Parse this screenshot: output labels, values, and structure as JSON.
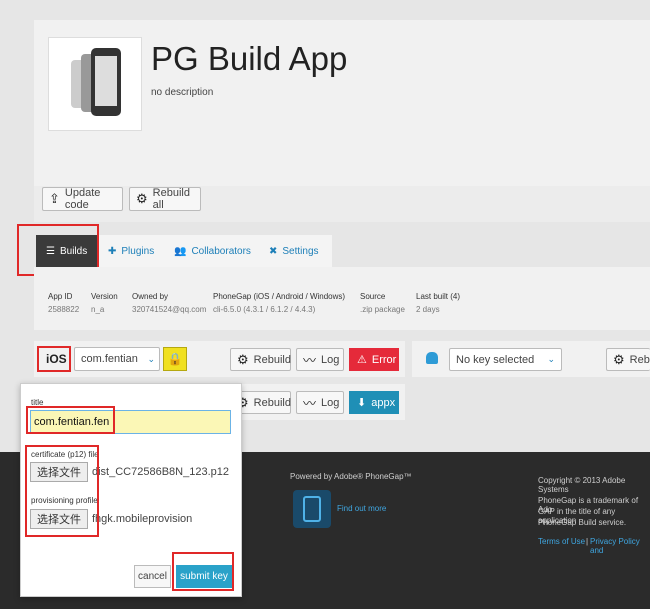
{
  "app": {
    "title": "PG Build App",
    "description": "no description"
  },
  "actions": {
    "update_code": "Update code",
    "rebuild_all": "Rebuild all"
  },
  "tabs": [
    {
      "label": "Builds"
    },
    {
      "label": "Plugins"
    },
    {
      "label": "Collaborators"
    },
    {
      "label": "Settings"
    }
  ],
  "meta": [
    {
      "header": "App ID",
      "value": "2588822"
    },
    {
      "header": "Version",
      "value": "n_a"
    },
    {
      "header": "Owned by",
      "value": "320741524@qq.com"
    },
    {
      "header": "PhoneGap (iOS / Android / Windows)",
      "value": "cli-6.5.0 (4.3.1 / 6.1.2 / 4.4.3)"
    },
    {
      "header": "Source",
      "value": ".zip package"
    },
    {
      "header": "Last built (4)",
      "value": "2 days"
    }
  ],
  "ios_row": {
    "platform": "iOS",
    "key_select": "com.fentian",
    "rebuild": "Rebuild",
    "log": "Log",
    "error": "Error"
  },
  "android_row": {
    "key_select": "No key selected",
    "rebuild": "Rebu"
  },
  "windows_row": {
    "rebuild": "Rebuild",
    "log": "Log",
    "appx": "appx"
  },
  "key_form": {
    "title_label": "title",
    "title_value": "com.fentian.fen",
    "cert_label": "certificate (p12) file",
    "cert_button": "选择文件",
    "cert_file": "dist_CC72586B8N_123.p12",
    "prov_label": "provisioning profile",
    "prov_button": "选择文件",
    "prov_file": "fhgk.mobileprovision",
    "cancel": "cancel",
    "submit": "submit key"
  },
  "footer": {
    "powered": "Powered by Adobe® PhoneGap™",
    "find_out": "Find out more",
    "copyright": "Copyright © 2013 Adobe Systems",
    "trademark_1": "PhoneGap is a trademark of Ado",
    "trademark_2": "GAP in the title of any application",
    "trademark_3": "PhoneGap Build service.",
    "terms": "Terms of Use",
    "privacy": "Privacy Policy and"
  },
  "colors": {
    "error": "#e52a3a",
    "appx": "#1f8fb6",
    "submit": "#2aa2c9",
    "footer_bg": "#2b2b2b",
    "highlight": "#e02828"
  }
}
